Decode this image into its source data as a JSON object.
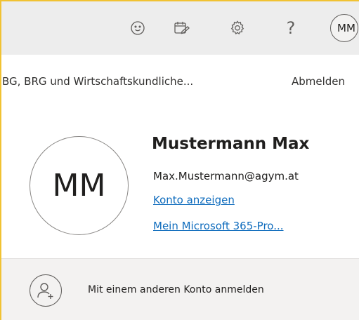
{
  "toolbar": {
    "icons": [
      "smiley-icon",
      "calendar-check-icon",
      "gear-icon",
      "help-icon"
    ],
    "help_glyph": "?",
    "avatar_initials": "MM"
  },
  "org": {
    "name": "BG, BRG und Wirtschaftskundliche...",
    "signout_label": "Abmelden"
  },
  "profile": {
    "initials": "MM",
    "name": "Mustermann Max",
    "email": "Max.Mustermann@agym.at",
    "view_account_label": "Konto anzeigen",
    "m365_label": "Mein Microsoft 365-Pro..."
  },
  "other_account": {
    "label": "Mit einem anderen Konto anmelden"
  },
  "colors": {
    "accent_border": "#f1c232",
    "link": "#0f6cbd"
  }
}
